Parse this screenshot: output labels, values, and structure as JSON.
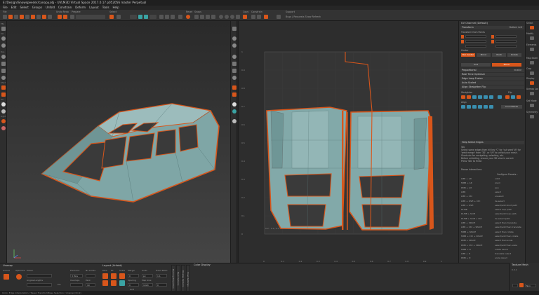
{
  "window": {
    "title": "E:/Design/Snowspeeder/canopy.obj - UVLM3D Virtual Space 2017.0.17 p052056 master Perpetual"
  },
  "menu": [
    "File",
    "Edit",
    "Select",
    "Groups",
    "Unfold",
    "Constrain",
    "Deform",
    "Layout",
    "Tools",
    "Help"
  ],
  "toolbar": {
    "labels": {
      "file": "File",
      "undo_redo": "Undo Redo",
      "prepare": "Prepare",
      "select": "Select",
      "reset": "Reset",
      "snaps": "Snaps",
      "copy": "Copy",
      "constrain": "Constrain",
      "support": "Support"
    },
    "support_text": "Bugs | Requests  Show Refresh"
  },
  "uv_panel": {
    "title": "UV Channel (Default)",
    "transform": "Transform",
    "transform_mode": "Bottom Left",
    "transform_from": "Transform from Points",
    "center": "Center",
    "center_tabs": [
      "Bar Center",
      "Mirror",
      "Multi",
      "Rotate"
    ],
    "unit_tabs": [
      "Unit",
      "Mirror"
    ],
    "sections": [
      "Proportional",
      "Real Time Optimize",
      "Edge Loop Fusion",
      "Auto Scaled",
      "Align Straighten Flip"
    ],
    "proportional_val": "enable",
    "straighten": "Straighten",
    "flip": "Flip",
    "align": "Align",
    "count_mode": "Count Mode",
    "help_header": "Help Select Edges",
    "help_text": [
      "Tab",
      "Select some edges then hit key 'C' for 'cut seed' W' for",
      "'weld merge' from '3D', or 'UV' to unfold your mesh.",
      "Shortcuts for navigating, selecting, etc.",
      "Before unfolding, ensure your 3D view is correct",
      "Press 'Tab' to finish"
    ],
    "mouse_hdr": "Mouse Interactions",
    "mouse_right": "Configure Presets...",
    "hotkeys": [
      [
        "LMB + Alt",
        "orbit"
      ],
      [
        "MMB + Alt",
        "zoom"
      ],
      [
        "RMB + Alt",
        "pan"
      ],
      [
        "LMB",
        "select"
      ],
      [
        "LMB + Ctrl",
        "unselect"
      ],
      [
        "LMB + Shift + Ctrl",
        "de-select"
      ],
      [
        "LMB + Shift",
        "select/add short path"
      ],
      [
        "DLMB",
        "select loop path"
      ],
      [
        "DLMB + Shift",
        "select/add loop path"
      ],
      [
        "DLMB + Shift + Ctrl",
        "de-select path"
      ],
      [
        "LMB + SPACE",
        "select then translate"
      ],
      [
        "LMB + Ctrl + SPACE",
        "select/add then translate"
      ],
      [
        "MMB + SPACE",
        "select then rotate"
      ],
      [
        "MMB + Ctrl + SPACE",
        "select/add then rotate"
      ],
      [
        "RMB + SPACE",
        "select then scale"
      ],
      [
        "RMB + Ctrl + SPACE",
        "select/add then scale"
      ],
      [
        "MMB + D",
        "rotate island"
      ],
      [
        "LMB + D",
        "translate island"
      ],
      [
        "RMB + D",
        "scale island"
      ]
    ]
  },
  "right_strip": {
    "labels": [
      "Select",
      "Modify",
      "Elements",
      "Map Seam",
      "Crop",
      "Display",
      "Uvmap Loc",
      "Set Mode",
      "Symmetry"
    ]
  },
  "viewport_3d": {
    "left_labels": [
      "Elts",
      "Sel",
      "Dsp",
      "Shad",
      "UV Cut",
      "Light"
    ]
  },
  "uv_view": {
    "x_ticks": [
      "0",
      "0.1",
      "0.2",
      "0.3",
      "0.4",
      "0.5",
      "0.6",
      "0.7",
      "0.8",
      "0.9",
      "1"
    ],
    "y_ticks": [
      "1",
      "0.9",
      "0.8",
      "0.7",
      "0.6",
      "0.5",
      "0.4",
      "0.3",
      "0.2",
      "0.1",
      "0"
    ],
    "sample_label": "0.2 : 0.1 / 0.0"
  },
  "bottom": {
    "unwrap": "Unwrap",
    "unfold_lbl": "Unfold",
    "optimize_lbl": "Optimize",
    "power_lbl": "Power",
    "precision_lbl": "Precision",
    "no_limits_lbl": "No Limits",
    "pin_lbl": "Pin",
    "angles_lengths_lbl": "Angles/Lengths",
    "overlaps_lbl": "Overlaps",
    "pack_lbl": "Pack",
    "precision_val": "3 Pins",
    "pack_val": "10",
    "layout": "Layout (Unfold)",
    "pack": "Pack",
    "fit": "Fit",
    "scale": "Scale",
    "margin_lbl": "Margin",
    "grid_lbl": "Grid",
    "spacing_lbl": "Spacing",
    "map_size_lbl": "Map Size",
    "fixed_ratio_lbl": "Fixed Ratio",
    "units_lbl": "Units",
    "margin_val": "0",
    "spacing_val": "0",
    "mapsize_val": "1024",
    "px_val": "px",
    "fixed_val": "1:1",
    "pct_val": "0",
    "tabs": [
      "Packing Properties",
      "Pack Options",
      "Display Options",
      "Snap Settings"
    ],
    "color_display": "Color Display",
    "texture_hdr": "Texture Mesh",
    "texture_val": "0.0.1",
    "texture_right": "Non"
  },
  "status": "Undo: Edge Interpolation / Tween TransformBase Selection / Unwrap (Click)"
}
